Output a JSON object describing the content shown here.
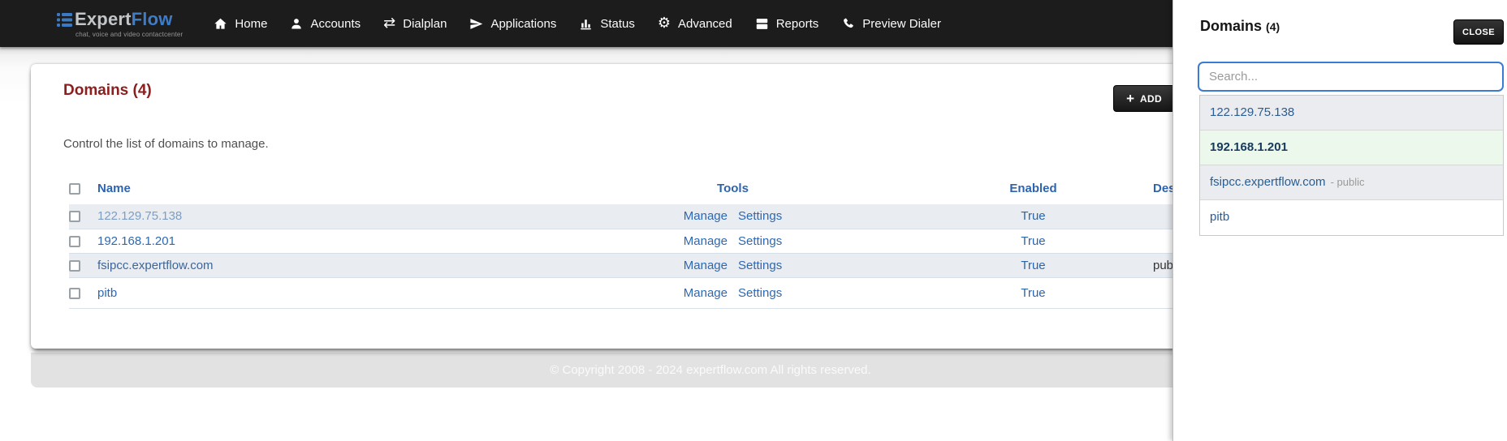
{
  "nav": {
    "logo": {
      "expert": "Expert",
      "flow": "Flow",
      "tagline": "chat, voice and video contactcenter"
    },
    "items": [
      {
        "label": "Home"
      },
      {
        "label": "Accounts"
      },
      {
        "label": "Dialplan"
      },
      {
        "label": "Applications"
      },
      {
        "label": "Status"
      },
      {
        "label": "Advanced"
      },
      {
        "label": "Reports"
      },
      {
        "label": "Preview Dialer"
      }
    ]
  },
  "main": {
    "title": "Domains (4)",
    "subtitle": "Control the list of domains to manage.",
    "add_button": "ADD",
    "table": {
      "headers": [
        "Name",
        "Tools",
        "Enabled",
        "Description"
      ],
      "rows": [
        {
          "name": "122.129.75.138",
          "tools": [
            "Manage",
            "Settings"
          ],
          "enabled": "True",
          "description": ""
        },
        {
          "name": "192.168.1.201",
          "tools": [
            "Manage",
            "Settings"
          ],
          "enabled": "True",
          "description": ""
        },
        {
          "name": "fsipcc.expertflow.com",
          "tools": [
            "Manage",
            "Settings"
          ],
          "enabled": "True",
          "description": "public"
        },
        {
          "name": "pitb",
          "tools": [
            "Manage",
            "Settings"
          ],
          "enabled": "True",
          "description": ""
        }
      ]
    },
    "footer": "© Copyright 2008 - 2024 expertflow.com All rights reserved."
  },
  "panel": {
    "title": "Domains",
    "count": "(4)",
    "close_button": "CLOSE",
    "search_placeholder": "Search...",
    "items": [
      {
        "label": "122.129.75.138",
        "note": ""
      },
      {
        "label": "192.168.1.201",
        "note": ""
      },
      {
        "label": "fsipcc.expertflow.com",
        "note": "- public"
      },
      {
        "label": "pitb",
        "note": ""
      }
    ]
  },
  "colors": {
    "nav_bg": "#1c1c1c",
    "brand_blue": "#3d7cc9",
    "title_maroon": "#8c1e1e",
    "link_blue": "#2e68b2",
    "header_blue": "#2d64ad",
    "stripe_bg": "#e9edf2",
    "panel_row_bg": "#eaecef",
    "panel_highlight_bg": "#ecf8ec",
    "search_border": "#3a7bd5",
    "footer_bg": "#e2e2e2"
  }
}
